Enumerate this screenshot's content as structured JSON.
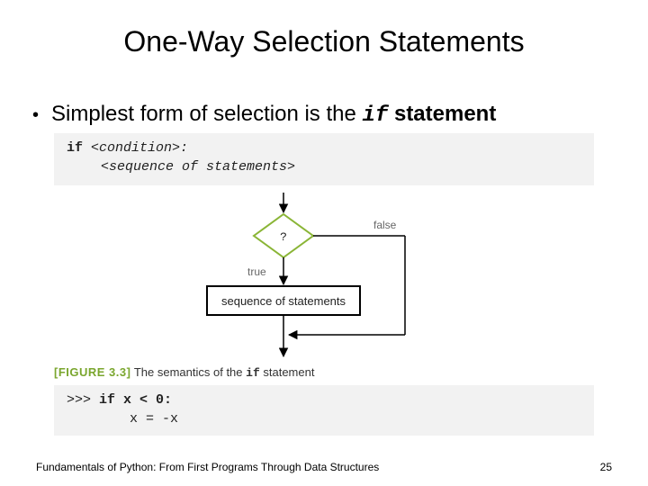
{
  "title": "One-Way Selection Statements",
  "bullet": {
    "prefix": "Simplest form of selection is the ",
    "code": "if",
    "suffix": " statement"
  },
  "syntax": {
    "line1_kw": "if",
    "line1_rest": " <condition>:",
    "line2": "<sequence of statements>"
  },
  "diagram": {
    "question": "?",
    "true_label": "true",
    "false_label": "false",
    "box_label": "sequence of statements"
  },
  "caption": {
    "figlabel": "[FIGURE 3.3]",
    "text_prefix": " The semantics of the ",
    "text_code": "if",
    "text_suffix": " statement"
  },
  "example": {
    "prompt": ">>> ",
    "line1": "if x < 0:",
    "line2": "x = -x"
  },
  "footer": {
    "left": "Fundamentals of Python: From First Programs Through Data Structures",
    "right": "25"
  }
}
